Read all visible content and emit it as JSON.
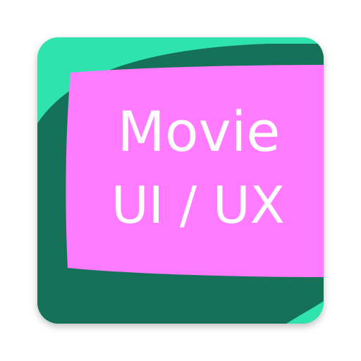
{
  "icon": {
    "title_line1": "Movie",
    "title_line2": "UI / UX",
    "colors": {
      "background": "#ffffff",
      "mint": "#2ee3ad",
      "dark_green": "#157158",
      "pink": "#ff7bff",
      "text": "#ffffff"
    }
  }
}
